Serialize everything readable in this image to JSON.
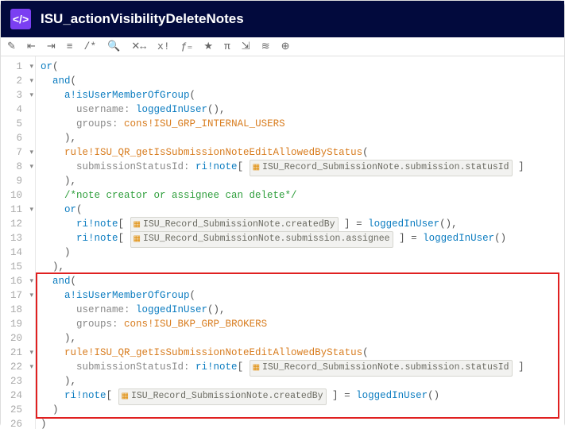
{
  "header": {
    "icon_text": "</>",
    "title": "ISU_actionVisibilityDeleteNotes"
  },
  "toolbar": {
    "items": [
      "✎",
      "⇤",
      "⇥",
      "≡",
      "/*",
      "🔍",
      "✕↔",
      "x!",
      "ƒ₌",
      "★",
      "π",
      "⇲",
      "≋",
      "⊕"
    ]
  },
  "lines": [
    {
      "n": 1,
      "fold": true
    },
    {
      "n": 2,
      "fold": true
    },
    {
      "n": 3,
      "fold": true
    },
    {
      "n": 4,
      "fold": false
    },
    {
      "n": 5,
      "fold": false
    },
    {
      "n": 6,
      "fold": false
    },
    {
      "n": 7,
      "fold": true
    },
    {
      "n": 8,
      "fold": true
    },
    {
      "n": 9,
      "fold": false
    },
    {
      "n": 10,
      "fold": false
    },
    {
      "n": 11,
      "fold": true
    },
    {
      "n": 12,
      "fold": false
    },
    {
      "n": 13,
      "fold": false
    },
    {
      "n": 14,
      "fold": false
    },
    {
      "n": 15,
      "fold": false
    },
    {
      "n": 16,
      "fold": true
    },
    {
      "n": 17,
      "fold": true
    },
    {
      "n": 18,
      "fold": false
    },
    {
      "n": 19,
      "fold": false
    },
    {
      "n": 20,
      "fold": false
    },
    {
      "n": 21,
      "fold": true
    },
    {
      "n": 22,
      "fold": true
    },
    {
      "n": 23,
      "fold": false
    },
    {
      "n": 24,
      "fold": false
    },
    {
      "n": 25,
      "fold": false
    },
    {
      "n": 26,
      "fold": false
    }
  ],
  "tok": {
    "or": "or",
    "and": "and",
    "isUserMemberOfGroup": "a!isUserMemberOfGroup",
    "username": "username",
    "loggedInUser": "loggedInUser",
    "groups": "groups",
    "cons": "cons!",
    "grp_internal": "ISU_GRP_INTERNAL_USERS",
    "grp_brokers": "ISU_BKP_GRP_BROKERS",
    "ruleFn": "rule!ISU_QR_getIsSubmissionNoteEditAllowedByStatus",
    "submissionStatusId": "submissionStatusId",
    "ri_note": "ri!note",
    "rec_statusId": "ISU_Record_SubmissionNote.submission.statusId",
    "rec_createdBy": "ISU_Record_SubmissionNote.createdBy",
    "rec_assignee": "ISU_Record_SubmissionNote.submission.assignee",
    "comment_note": "/*note creator or assignee can delete*/",
    "lp": "(",
    "rp": ")",
    "lb": "[",
    "rb": "]",
    "comma": ",",
    "colon": ":",
    "eq": "="
  },
  "highlight": {
    "top_line": 16,
    "bottom_line": 25
  }
}
